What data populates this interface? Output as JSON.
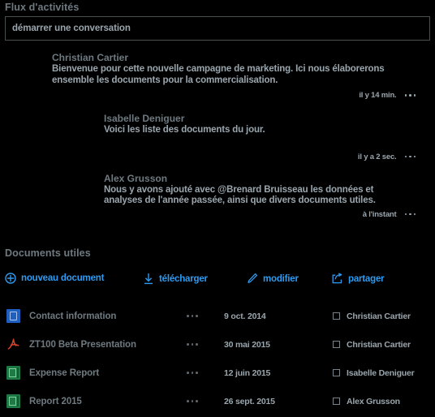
{
  "feed": {
    "title": "Flux d'activités",
    "composer": {
      "placeholder": "démarrer une conversation",
      "value": ""
    },
    "messages": [
      {
        "author": "Christian Cartier",
        "text": "Bienvenue pour cette nouvelle campagne de marketing. Ici nous élaborerons ensemble les documents pour la commercialisation.",
        "time": "il y 14 min.",
        "more_icon": "ellipsis-horizontal-icon"
      },
      {
        "author": "Isabelle Deniguer",
        "text": "Voici les liste des documents du jour.",
        "time": "il y a 2 sec.",
        "more_icon": "ellipsis-horizontal-icon"
      },
      {
        "author": "Alex Grusson",
        "text": "Nous y avons ajouté avec @Brenard Bruisseau les données et analyses de l'année passée, ainsi que divers documents utiles.",
        "time": "à l'instant",
        "more_icon": "ellipsis-horizontal-icon"
      }
    ]
  },
  "documents": {
    "title": "Documents utiles",
    "toolbar": [
      {
        "label": "nouveau document",
        "icon": "plus-circle-icon"
      },
      {
        "label": "télécharger",
        "icon": "download-arrow-icon"
      },
      {
        "label": "modifier",
        "icon": "pencil-icon"
      },
      {
        "label": "partager",
        "icon": "share-arrow-icon"
      }
    ],
    "rows": [
      {
        "name": "Contact information",
        "date": "9 oct. 2014",
        "owner": "Christian Cartier",
        "file_type": "word",
        "checked": false,
        "more_icon": "ellipsis-horizontal-icon"
      },
      {
        "name": "ZT100 Beta Presentation",
        "date": "30 mai 2015",
        "owner": "Christian Cartier",
        "file_type": "pdf",
        "checked": false,
        "more_icon": "ellipsis-horizontal-icon"
      },
      {
        "name": "Expense Report",
        "date": "12 juin 2015",
        "owner": "Isabelle Deniguer",
        "file_type": "excel",
        "checked": false,
        "more_icon": "ellipsis-horizontal-icon"
      },
      {
        "name": "Report 2015",
        "date": "26 sept. 2015",
        "owner": "Alex Grusson",
        "file_type": "excel",
        "checked": false,
        "more_icon": "ellipsis-horizontal-icon"
      }
    ]
  },
  "colors": {
    "background": "#000000",
    "accent": "#2e9bf0",
    "heading": "#6e7a80",
    "body_text": "#9aa6ad",
    "border": "#4a4f52",
    "word_blue": "#1f5fbf",
    "pdf_red": "#d9422b",
    "excel_green": "#1d7a45"
  }
}
